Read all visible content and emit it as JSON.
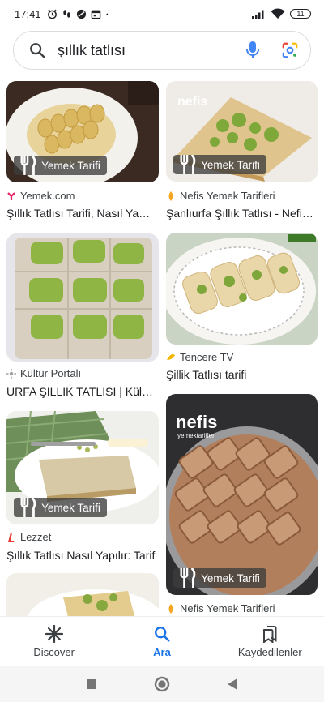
{
  "status_bar": {
    "time": "17:41",
    "battery": "11",
    "icons": [
      "alarm-clock-icon",
      "footsteps-icon",
      "vpn-icon",
      "calendar-icon",
      "dot-icon",
      "signal-icon",
      "wifi-icon",
      "battery-icon"
    ]
  },
  "search": {
    "query": "şıllık tatlısı",
    "icons": [
      "search-icon",
      "microphone-icon",
      "google-lens-icon"
    ]
  },
  "results": [
    {
      "chip": "Yemek Tarifi",
      "source": "Yemek.com",
      "source_icon": "yemek-com-icon",
      "title": "Şıllık Tatlısı Tarifi, Nasıl Yapılır?"
    },
    {
      "chip": "Yemek Tarifi",
      "source": "Nefis Yemek Tarifleri",
      "source_icon": "nefis-icon",
      "title": "Şanlıurfa Şıllık Tatlısı - Nefis Yemek"
    },
    {
      "chip": "",
      "source": "Kültür Portalı",
      "source_icon": "kultur-portali-icon",
      "title": "URFA ŞILLIK TATLISI | Kültür Portalı"
    },
    {
      "chip": "",
      "source": "Tencere TV",
      "source_icon": "tencere-tv-icon",
      "title": "Şillik Tatlısı tarifi"
    },
    {
      "chip": "Yemek Tarifi",
      "source": "Lezzet",
      "source_icon": "lezzet-icon",
      "title": "Şıllık Tatlısı Nasıl Yapılır: Tarif"
    },
    {
      "chip": "Yemek Tarifi",
      "source": "Nefis Yemek Tarifleri",
      "source_icon": "nefis-icon",
      "title": ""
    },
    {
      "chip": "",
      "source": "",
      "source_icon": "",
      "title": ""
    }
  ],
  "bottom_nav": {
    "items": [
      {
        "label": "Discover",
        "icon": "asterisk-icon",
        "active": false
      },
      {
        "label": "Ara",
        "icon": "search-icon",
        "active": true
      },
      {
        "label": "Kaydedilenler",
        "icon": "bookmarks-icon",
        "active": false
      }
    ]
  },
  "system_nav": {
    "icons": [
      "recents-square-icon",
      "home-circle-icon",
      "back-triangle-icon"
    ]
  },
  "colors": {
    "accent_blue": "#1a73e8",
    "mic_blue": "#4285f4",
    "chip_bg": "#3c3c3c",
    "text_primary": "#202124",
    "text_secondary": "#3c4043"
  }
}
